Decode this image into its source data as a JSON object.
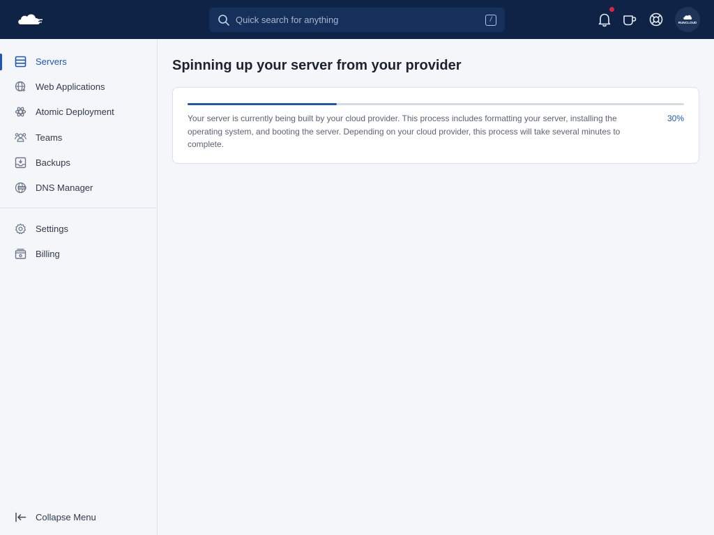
{
  "colors": {
    "topbar_bg": "#0f2347",
    "accent": "#1e57b7",
    "notification_dot": "#e0243a",
    "page_bg": "#f4f6fa"
  },
  "header": {
    "logo_icon": "cloud-logo-icon",
    "search": {
      "placeholder": "Quick search for anything",
      "value": "",
      "icon": "search-icon",
      "shortcut": "/"
    },
    "icons": [
      "bell-icon",
      "mug-icon",
      "lifebuoy-icon"
    ],
    "notification_badge": true,
    "avatar_text": "RUNCLOUD"
  },
  "sidebar": {
    "items": [
      {
        "label": "Servers",
        "icon": "server-icon",
        "active": true
      },
      {
        "label": "Web Applications",
        "icon": "globe-icon"
      },
      {
        "label": "Atomic Deployment",
        "icon": "atom-icon"
      },
      {
        "label": "Teams",
        "icon": "team-icon"
      },
      {
        "label": "Backups",
        "icon": "backup-icon"
      },
      {
        "label": "DNS Manager",
        "icon": "dns-icon"
      },
      {
        "label": "Settings",
        "icon": "gear-icon"
      },
      {
        "label": "Billing",
        "icon": "billing-icon"
      }
    ],
    "collapse_label": "Collapse Menu",
    "collapse_icon": "collapse-arrow-icon"
  },
  "main": {
    "title": "Spinning up your server from your provider",
    "progress": {
      "percent_value": 30,
      "percent_label": "30%",
      "message": "Your server is currently being built by your cloud provider. This process includes formatting your server, installing the operating system, and booting the server. Depending on your cloud provider, this process will take several minutes to complete."
    }
  }
}
